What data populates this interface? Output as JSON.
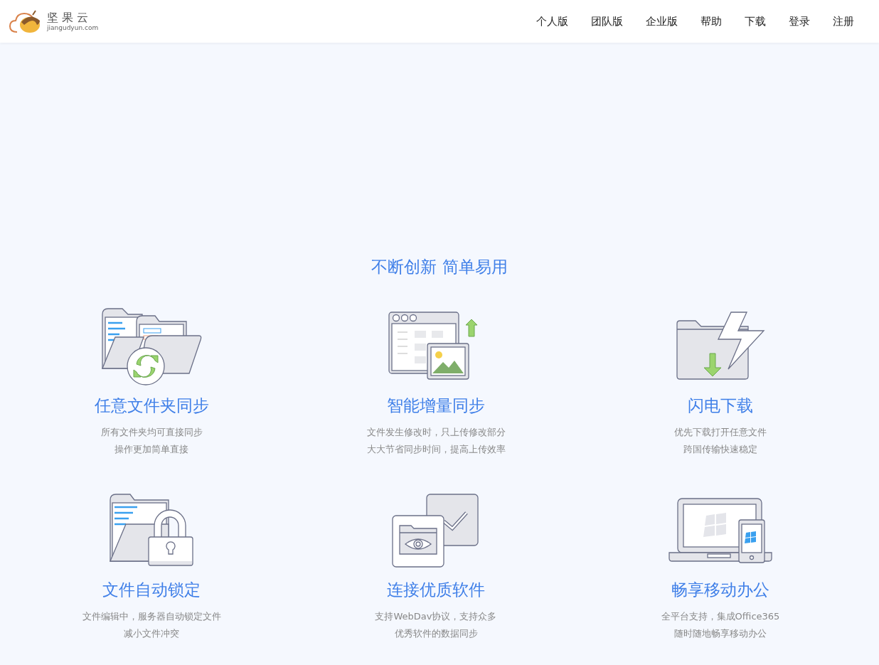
{
  "header": {
    "logo_name": "坚果云",
    "logo_domain": "jiangudyun.com",
    "nav": [
      {
        "label": "个人版"
      },
      {
        "label": "团队版"
      },
      {
        "label": "企业版"
      },
      {
        "label": "帮助"
      },
      {
        "label": "下载"
      },
      {
        "label": "登录"
      },
      {
        "label": "注册"
      }
    ]
  },
  "section": {
    "heading": "不断创新 简单易用",
    "features": [
      {
        "kind": "folder-sync",
        "title": "任意文件夹同步",
        "lines": [
          "所有文件夹均可直接同步",
          "操作更加简单直接"
        ]
      },
      {
        "kind": "incremental",
        "title": "智能增量同步",
        "lines": [
          "文件发生修改时，只上传修改部分",
          "大大节省同步时间，提高上传效率"
        ]
      },
      {
        "kind": "lightning",
        "title": "闪电下载",
        "lines": [
          "优先下载打开任意文件",
          "跨国传输快速稳定"
        ]
      },
      {
        "kind": "lock",
        "title": "文件自动锁定",
        "lines": [
          "文件编辑中，服务器自动锁定文件",
          "减小文件冲突"
        ]
      },
      {
        "kind": "connect",
        "title": "连接优质软件",
        "lines": [
          "支持WebDav协议，支持众多",
          "优秀软件的数据同步"
        ]
      },
      {
        "kind": "mobile",
        "title": "畅享移动办公",
        "lines": [
          "全平台支持，集成Office365",
          "随时随地畅享移动办公"
        ]
      }
    ]
  }
}
